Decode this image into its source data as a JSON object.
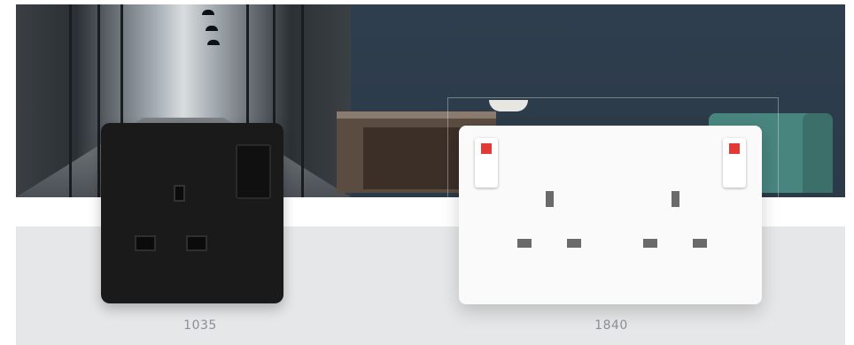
{
  "products": [
    {
      "code": "1035",
      "finish": "black"
    },
    {
      "code": "1840",
      "finish": "white"
    }
  ],
  "colors": {
    "band_bg": "#e6e7e8",
    "caption": "#8a8f95",
    "black_plate": "#1a1a1a",
    "white_plate": "#fafafa",
    "switch_indicator": "#e53935"
  }
}
